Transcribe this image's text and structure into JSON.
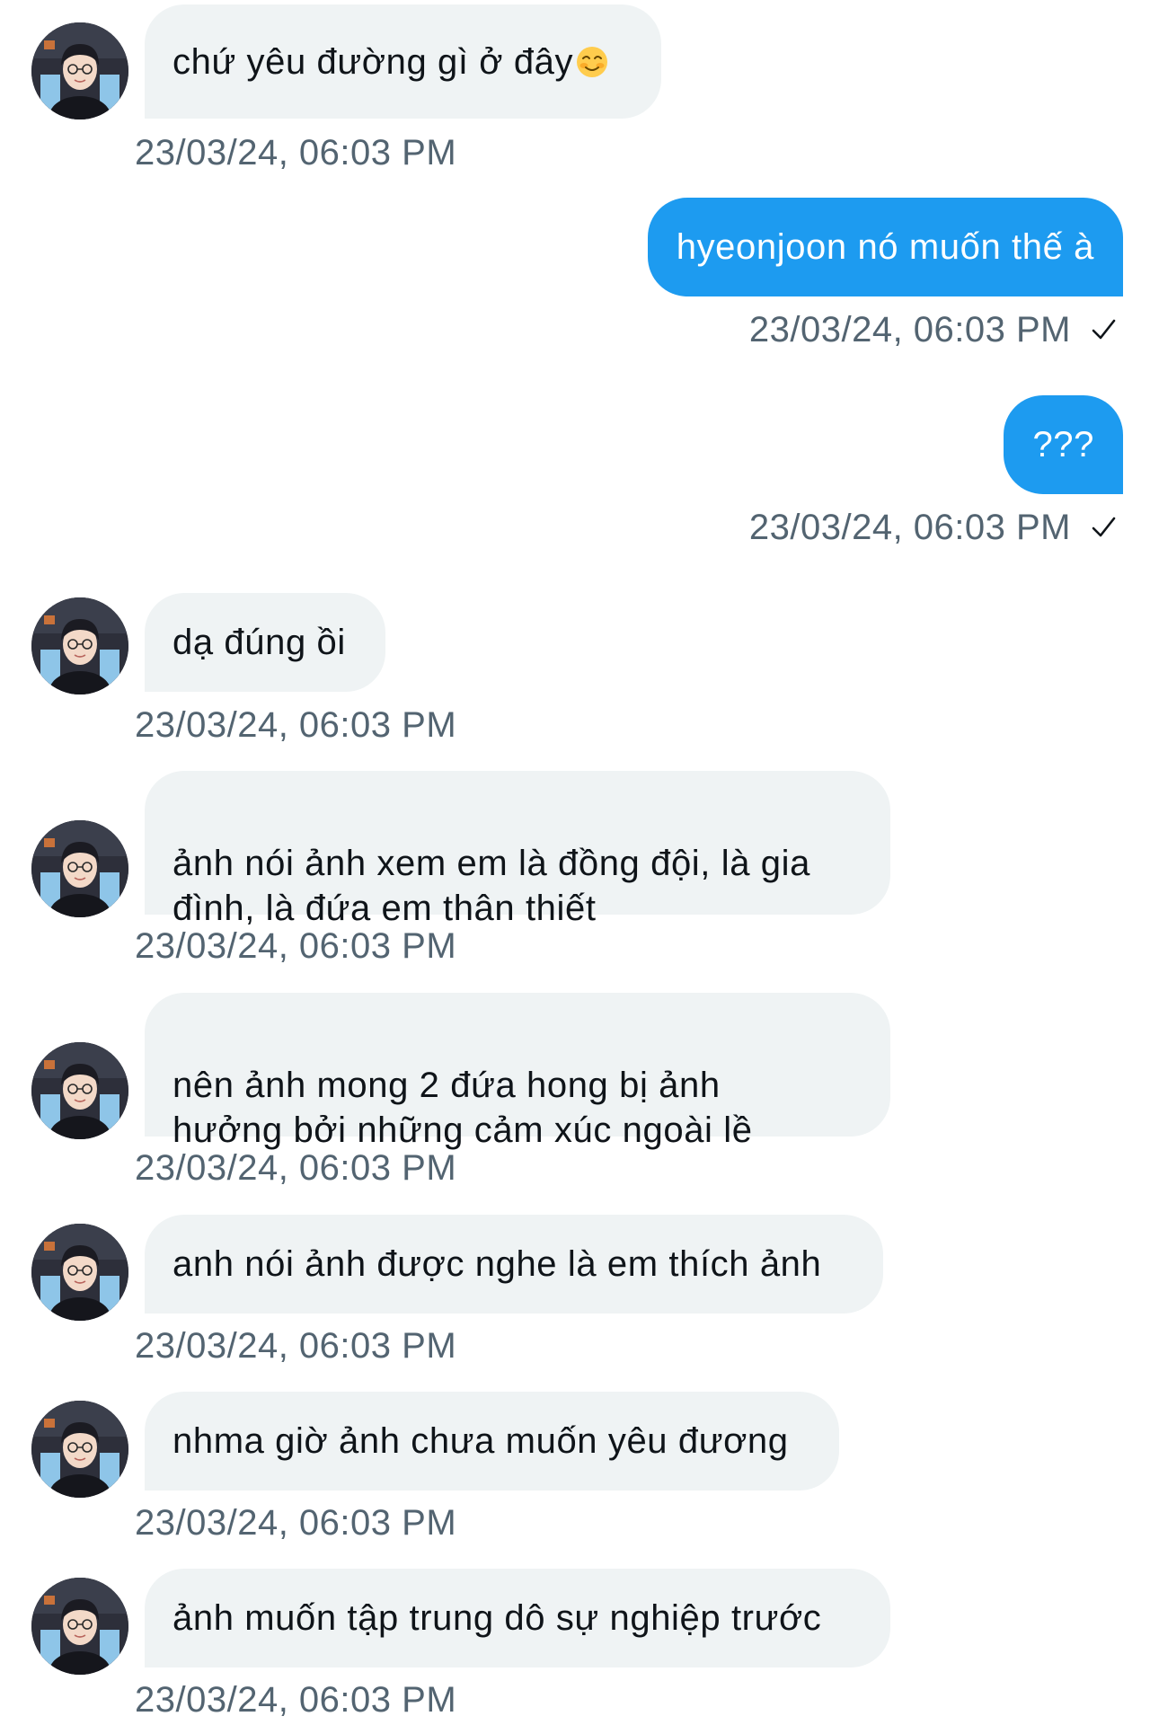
{
  "colors": {
    "incoming_bubble": "#eff3f4",
    "outgoing_bubble": "#1d9bf0",
    "timestamp": "#536471",
    "text": "#0f1419"
  },
  "messages": [
    {
      "direction": "incoming",
      "text": "chứ yêu đường gì ở đây",
      "emoji": "smiling-blush-emoji",
      "timestamp": "23/03/24, 06:03 PM"
    },
    {
      "direction": "outgoing",
      "text": "hyeonjoon nó muốn thế à",
      "timestamp": "23/03/24, 06:03 PM",
      "status": "sent-check-icon"
    },
    {
      "direction": "outgoing",
      "text": "???",
      "timestamp": "23/03/24, 06:03 PM",
      "status": "sent-check-icon"
    },
    {
      "direction": "incoming",
      "text": "dạ đúng ồi",
      "timestamp": "23/03/24, 06:03 PM"
    },
    {
      "direction": "incoming",
      "text": "ảnh nói ảnh xem em là đồng đội, là gia\nđình, là đứa em thân thiết",
      "timestamp": "23/03/24, 06:03 PM"
    },
    {
      "direction": "incoming",
      "text": "nên ảnh mong 2 đứa hong bị ảnh\nhưởng bởi những cảm xúc ngoài lề",
      "timestamp": "23/03/24, 06:03 PM"
    },
    {
      "direction": "incoming",
      "text": "anh nói ảnh được nghe là em thích ảnh",
      "timestamp": "23/03/24, 06:03 PM"
    },
    {
      "direction": "incoming",
      "text": "nhma giờ ảnh chưa muốn yêu đương",
      "timestamp": "23/03/24, 06:03 PM"
    },
    {
      "direction": "incoming",
      "text": "ảnh muốn tập trung dô sự nghiệp trước",
      "timestamp": "23/03/24, 06:03 PM"
    }
  ]
}
